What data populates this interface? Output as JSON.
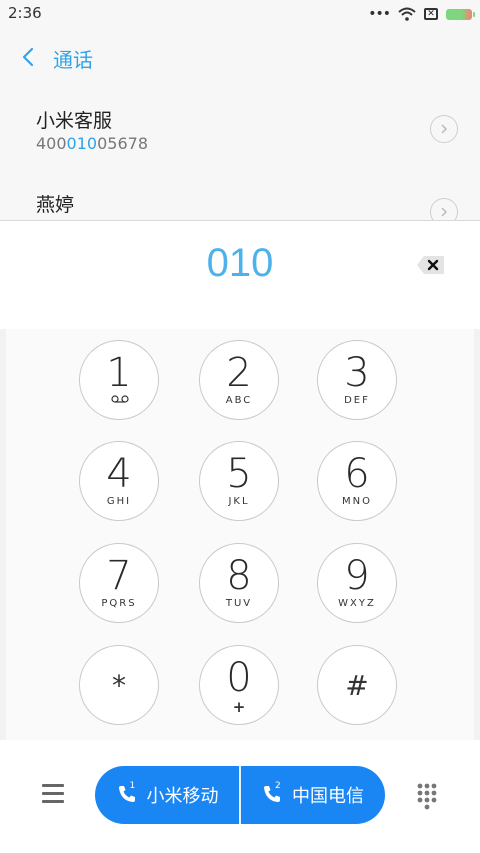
{
  "status": {
    "time": "2:36"
  },
  "header": {
    "title": "通话"
  },
  "results": [
    {
      "name": "小米客服",
      "number_pre": "400",
      "number_match": "010",
      "number_post": "05678"
    },
    {
      "name": "燕婷"
    }
  ],
  "display": {
    "digits": "010"
  },
  "keypad": [
    {
      "digit": "1",
      "letters": ""
    },
    {
      "digit": "2",
      "letters": "ABC"
    },
    {
      "digit": "3",
      "letters": "DEF"
    },
    {
      "digit": "4",
      "letters": "GHI"
    },
    {
      "digit": "5",
      "letters": "JKL"
    },
    {
      "digit": "6",
      "letters": "MNO"
    },
    {
      "digit": "7",
      "letters": "PQRS"
    },
    {
      "digit": "8",
      "letters": "TUV"
    },
    {
      "digit": "9",
      "letters": "WXYZ"
    },
    {
      "digit": "*",
      "letters": ""
    },
    {
      "digit": "0",
      "letters": "+"
    },
    {
      "digit": "#",
      "letters": ""
    }
  ],
  "bottom": {
    "sim1_label": "小米移动",
    "sim1_index": "1",
    "sim2_label": "中国电信",
    "sim2_index": "2"
  },
  "colors": {
    "accent": "#2fa4e8",
    "call_button": "#1a86f4",
    "digits": "#4db2ec"
  }
}
